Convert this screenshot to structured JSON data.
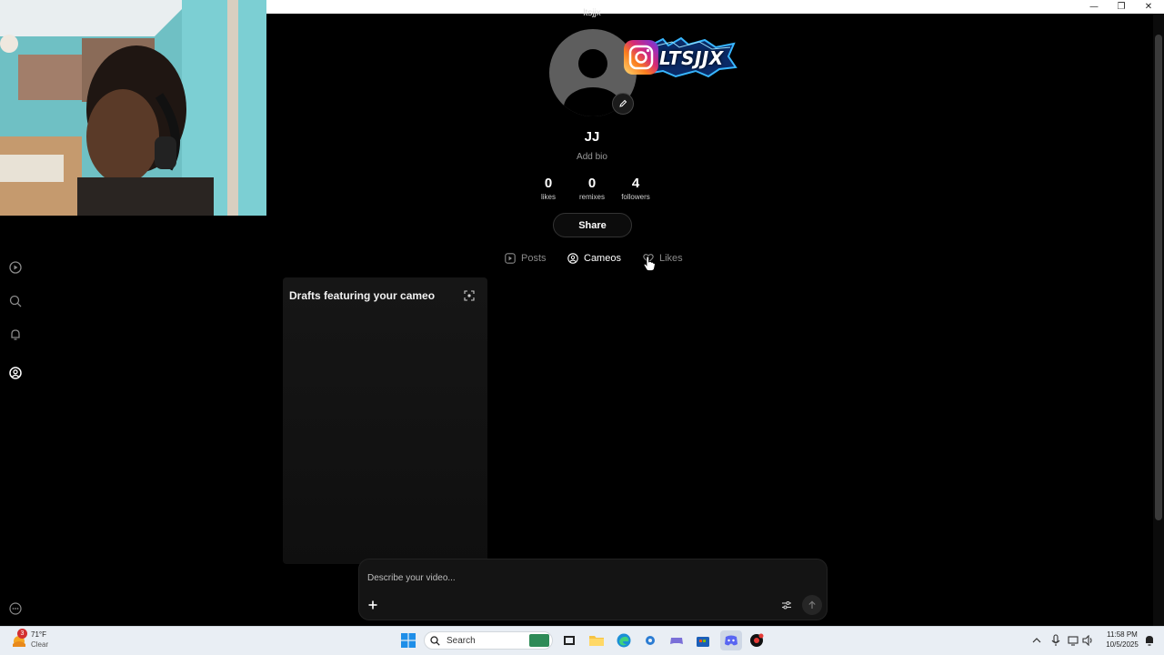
{
  "profile": {
    "handle": "ltsjjx",
    "name": "JJ",
    "bio_placeholder": "Add bio",
    "logo_text": "LTSJJX",
    "stats": [
      {
        "value": "0",
        "label": "likes"
      },
      {
        "value": "0",
        "label": "remixes"
      },
      {
        "value": "4",
        "label": "followers"
      }
    ],
    "share_label": "Share"
  },
  "tabs": [
    {
      "label": "Posts",
      "icon": "play-square-icon",
      "active": false
    },
    {
      "label": "Cameos",
      "icon": "person-circle-icon",
      "active": true
    },
    {
      "label": "Likes",
      "icon": "heart-icon",
      "active": false
    }
  ],
  "drafts": {
    "title": "Drafts featuring your cameo",
    "icon": "focus-frame-icon"
  },
  "composer": {
    "placeholder": "Describe your video...",
    "add_icon": "plus-icon",
    "settings_icon": "sliders-icon",
    "send_icon": "arrow-up-icon"
  },
  "left_rail": [
    "play-icon",
    "search-icon",
    "bell-icon",
    "profile-icon",
    "more-icon"
  ],
  "taskbar": {
    "weather_temp": "71°F",
    "weather_desc": "Clear",
    "weather_badge": "3",
    "search_label": "Search",
    "time": "11:58 PM",
    "date": "10/5/2025"
  },
  "colors": {
    "background": "#000000",
    "card": "#141414",
    "taskbar": "#e9eef4",
    "instagram_gradient": [
      "#feda75",
      "#d62976",
      "#962fbf",
      "#4f5bd5"
    ],
    "lightning": "#38b6ff"
  }
}
